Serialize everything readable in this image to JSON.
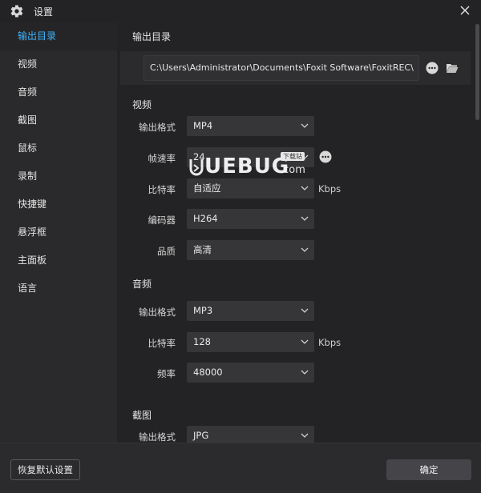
{
  "window": {
    "title": "设置",
    "icon": "gear-icon",
    "close_icon": "close-icon"
  },
  "sidebar": {
    "items": [
      {
        "label": "输出目录",
        "active": true
      },
      {
        "label": "视频"
      },
      {
        "label": "音频"
      },
      {
        "label": "截图"
      },
      {
        "label": "鼠标"
      },
      {
        "label": "录制"
      },
      {
        "label": "快捷键"
      },
      {
        "label": "悬浮框"
      },
      {
        "label": "主面板"
      },
      {
        "label": "语言"
      }
    ]
  },
  "output": {
    "section_title": "输出目录",
    "path": "C:\\Users\\Administrator\\Documents\\Foxit Software\\FoxitREC\\",
    "more_icon": "more-icon",
    "folder_icon": "folder-open-icon"
  },
  "video": {
    "section_title": "视频",
    "format_label": "输出格式",
    "format_value": "MP4",
    "fps_label": "帧速率",
    "fps_value": "24",
    "bitrate_label": "比特率",
    "bitrate_value": "自适应",
    "bitrate_unit": "Kbps",
    "encoder_label": "编码器",
    "encoder_value": "H264",
    "quality_label": "品质",
    "quality_value": "高清"
  },
  "audio": {
    "section_title": "音频",
    "format_label": "输出格式",
    "format_value": "MP3",
    "bitrate_label": "比特率",
    "bitrate_value": "128",
    "bitrate_unit": "Kbps",
    "rate_label": "频率",
    "rate_value": "48000"
  },
  "screenshot": {
    "section_title": "截图",
    "format_label": "输出格式",
    "format_value": "JPG"
  },
  "footer": {
    "reset_label": "恢复默认设置",
    "ok_label": "确定"
  },
  "watermark": {
    "text": "UEBUG",
    "suffix": ".com",
    "tag": "下载站"
  },
  "colors": {
    "accent": "#3fb4ff",
    "panel": "#232325",
    "sidebar": "#2a2a2c",
    "select": "#363639"
  }
}
